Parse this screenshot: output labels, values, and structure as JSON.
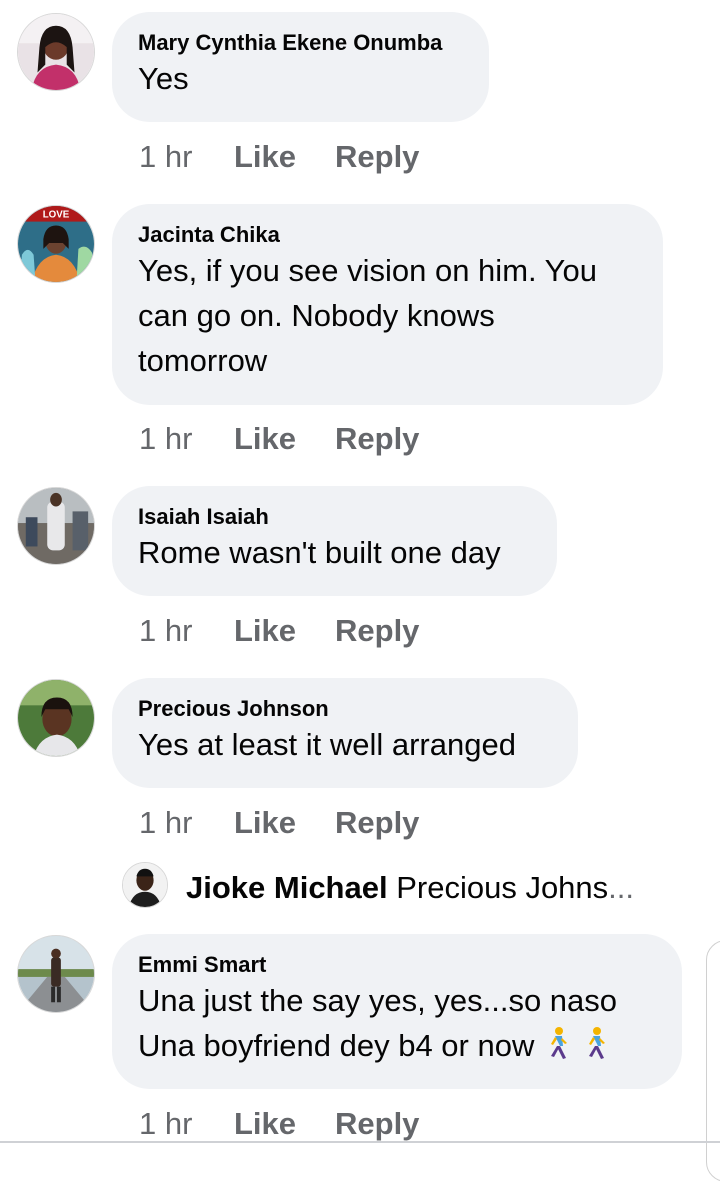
{
  "comments": [
    {
      "author": "Mary Cynthia Ekene Onumba",
      "lines": [
        "Yes"
      ],
      "time": "1 hr",
      "like": "Like",
      "reply": "Reply"
    },
    {
      "author": "Jacinta Chika",
      "lines": [
        "Yes, if you see vision on him. You",
        "can go on. Nobody knows",
        "tomorrow"
      ],
      "time": "1 hr",
      "like": "Like",
      "reply": "Reply",
      "avatar_banner": "LOVE"
    },
    {
      "author": "Isaiah Isaiah",
      "lines": [
        "Rome wasn't built one day"
      ],
      "time": "1 hr",
      "like": "Like",
      "reply": "Reply"
    },
    {
      "author": "Precious Johnson",
      "lines": [
        "Yes at least it well arranged"
      ],
      "time": "1 hr",
      "like": "Like",
      "reply": "Reply"
    },
    {
      "author": "Emmi Smart",
      "lines": [
        "Una just the say yes, yes...so naso",
        "Una boyfriend dey b4 or now"
      ],
      "emoji": [
        "person-walking-emoji",
        "person-walking-emoji"
      ],
      "time": "1 hr",
      "like": "Like",
      "reply": "Reply"
    }
  ],
  "reply_preview": {
    "author": "Jioke Michael",
    "snippet": "Precious Johns",
    "ellipsis": "..."
  },
  "colors": {
    "bubble": "#f0f2f5",
    "meta_text": "#65676b",
    "text": "#050505"
  }
}
